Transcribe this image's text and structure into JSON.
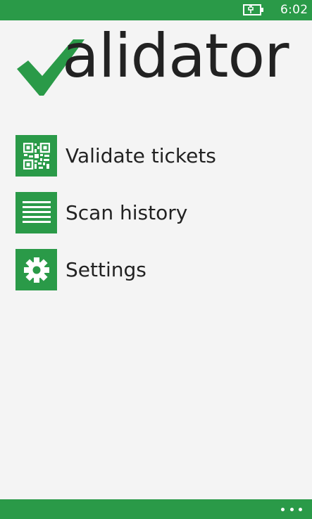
{
  "status_bar": {
    "time": "6:02",
    "battery_icon": "battery-charging-icon",
    "color": "#2a9a48"
  },
  "logo": {
    "text": "alidator",
    "check_icon": "checkmark-icon",
    "check_color": "#2a9a48"
  },
  "menu": {
    "items": [
      {
        "label": "Validate tickets",
        "icon": "qr-code-icon"
      },
      {
        "label": "Scan history",
        "icon": "list-icon"
      },
      {
        "label": "Settings",
        "icon": "gear-icon"
      }
    ]
  },
  "app_bar": {
    "more_icon": "more-dots-icon"
  }
}
